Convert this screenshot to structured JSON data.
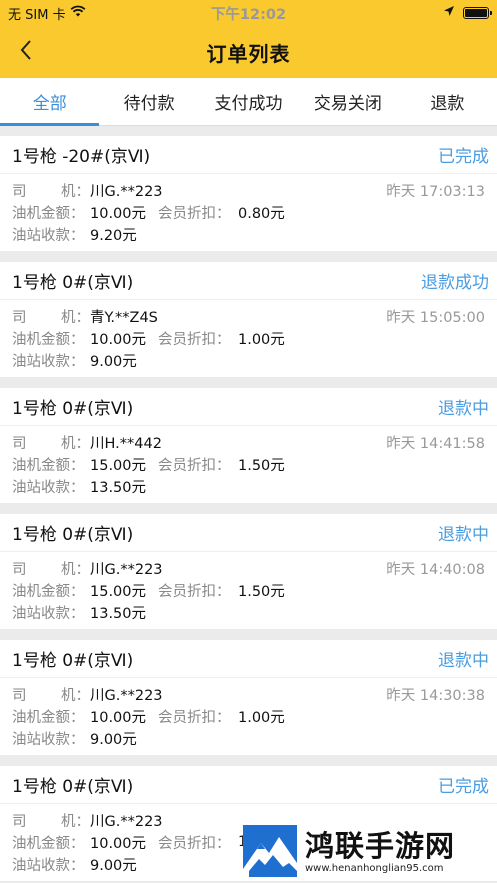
{
  "status_bar": {
    "carrier": "无 SIM 卡",
    "time": "下午12:02"
  },
  "nav": {
    "title": "订单列表"
  },
  "tabs": [
    {
      "label": "全部",
      "active": true
    },
    {
      "label": "待付款",
      "active": false
    },
    {
      "label": "支付成功",
      "active": false
    },
    {
      "label": "交易关闭",
      "active": false
    },
    {
      "label": "退款",
      "active": false
    }
  ],
  "labels": {
    "driver_1": "司",
    "driver_2": "机：",
    "amount": "油机金额：",
    "discount": "会员折扣：",
    "received": "油站收款："
  },
  "orders": [
    {
      "gun": "1号枪 -20#(京Ⅵ)",
      "status": "已完成",
      "driver": "川G.**223",
      "time": "昨天 17:03:13",
      "amount": "10.00元",
      "discount": "0.80元",
      "received": "9.20元"
    },
    {
      "gun": "1号枪 0#(京Ⅵ)",
      "status": "退款成功",
      "driver": "青Y.**Z4S",
      "time": "昨天 15:05:00",
      "amount": "10.00元",
      "discount": "1.00元",
      "received": "9.00元"
    },
    {
      "gun": "1号枪 0#(京Ⅵ)",
      "status": "退款中",
      "driver": "川H.**442",
      "time": "昨天 14:41:58",
      "amount": "15.00元",
      "discount": "1.50元",
      "received": "13.50元"
    },
    {
      "gun": "1号枪 0#(京Ⅵ)",
      "status": "退款中",
      "driver": "川G.**223",
      "time": "昨天 14:40:08",
      "amount": "15.00元",
      "discount": "1.50元",
      "received": "13.50元"
    },
    {
      "gun": "1号枪 0#(京Ⅵ)",
      "status": "退款中",
      "driver": "川G.**223",
      "time": "昨天 14:30:38",
      "amount": "10.00元",
      "discount": "1.00元",
      "received": "9.00元"
    },
    {
      "gun": "1号枪 0#(京Ⅵ)",
      "status": "已完成",
      "driver": "川G.**223",
      "time": "",
      "amount": "10.00元",
      "discount": "1",
      "received": "9.00元"
    }
  ],
  "watermark": {
    "title": "鸿联手游网",
    "url": "www.henanhonglian95.com"
  },
  "colors": {
    "accent": "#3b8fd9",
    "header": "#f9c92e",
    "status": "#4a9de2"
  },
  "icons": [
    "back-chevron-icon",
    "wifi-icon",
    "location-arrow-icon",
    "battery-icon",
    "mountain-logo-icon"
  ]
}
